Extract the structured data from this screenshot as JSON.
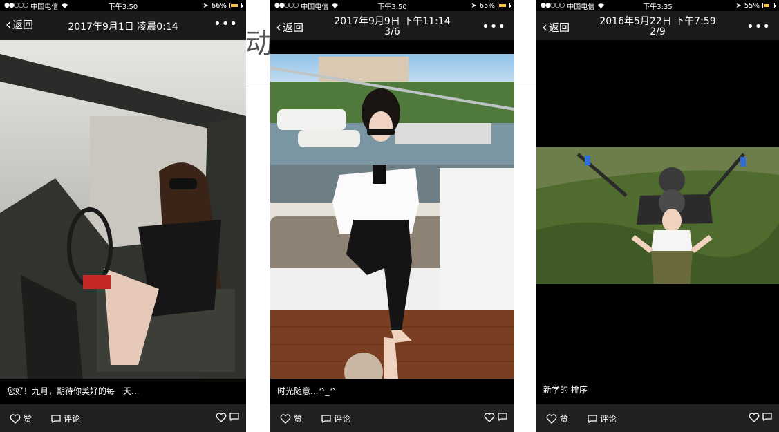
{
  "background": {
    "glyph": "动"
  },
  "screens": [
    {
      "status": {
        "carrier": "中国电信",
        "time": "下午3:50",
        "battery": "66%",
        "battery_level": 0.66
      },
      "nav": {
        "back": "返回",
        "title": "2017年9月1日 凌晨0:14",
        "counter": ""
      },
      "caption": "您好！九月，期待你美好的每一天...",
      "actions": {
        "like": "赞",
        "comment": "评论"
      }
    },
    {
      "status": {
        "carrier": "中国电信",
        "time": "下午3:50",
        "battery": "65%",
        "battery_level": 0.65
      },
      "nav": {
        "back": "返回",
        "title": "2017年9月9日 下午11:14",
        "counter": "3/6"
      },
      "caption": "时光随意...^_^",
      "actions": {
        "like": "赞",
        "comment": "评论"
      }
    },
    {
      "status": {
        "carrier": "中国电信",
        "time": "下午3:35",
        "battery": "55%",
        "battery_level": 0.55
      },
      "nav": {
        "back": "返回",
        "title": "2016年5月22日 下午7:59",
        "counter": "2/9"
      },
      "caption": "新学的 排序",
      "actions": {
        "like": "赞",
        "comment": "评论"
      }
    }
  ],
  "colors": {
    "navbar": "#1b1b1b",
    "actionbar": "#202020",
    "battery": "#f5c242"
  }
}
